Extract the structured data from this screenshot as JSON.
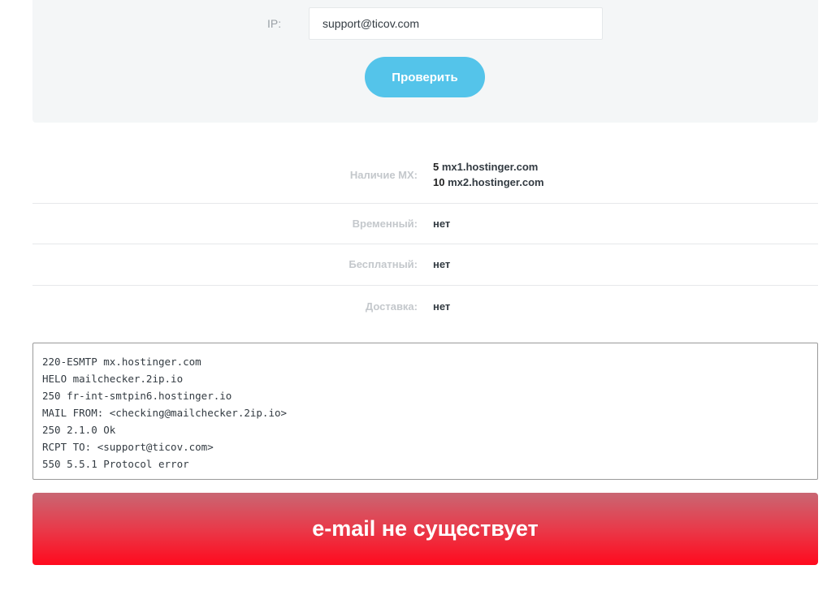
{
  "form": {
    "ip_label": "IP:",
    "ip_value": "support@ticov.com",
    "check_button": "Проверить"
  },
  "results": {
    "mx": {
      "label": "Наличие MX:",
      "records": [
        {
          "priority": "5",
          "host": "mx1.hostinger.com"
        },
        {
          "priority": "10",
          "host": "mx2.hostinger.com"
        }
      ]
    },
    "temporary": {
      "label": "Временный:",
      "value": "нет"
    },
    "free": {
      "label": "Бесплатный:",
      "value": "нет"
    },
    "delivery": {
      "label": "Доставка:",
      "value": "нет"
    }
  },
  "smtp_log": [
    "220-ESMTP mx.hostinger.com",
    "HELO mailchecker.2ip.io",
    "250 fr-int-smtpin6.hostinger.io",
    "MAIL FROM: <checking@mailchecker.2ip.io>",
    "250 2.1.0 Ok",
    "RCPT TO: <support@ticov.com>",
    "550 5.5.1 Protocol error"
  ],
  "result_banner": "e-mail не существует",
  "colors": {
    "button": "#54c4ea",
    "banner_top": "#c96773",
    "banner_bottom": "#ff0a1e",
    "panel_bg": "#f4f6f7"
  }
}
